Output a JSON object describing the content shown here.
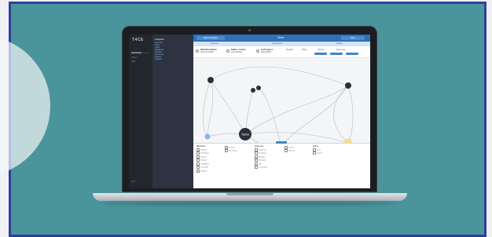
{
  "app": {
    "logo": "T4CE",
    "title": "Tasks",
    "top_left_button": "Select Analytics",
    "top_right_button": "Save"
  },
  "sidebar": {
    "items": [
      {
        "label": "Dashboard",
        "active": true
      },
      {
        "label": "Admin",
        "active": false
      },
      {
        "label": "Help",
        "active": false
      }
    ],
    "footer": "v1.0"
  },
  "subpanel": {
    "title": "Analytics",
    "links": [
      "Overview",
      "Users",
      "Tasks",
      "Workflows",
      "Timeline",
      "Resources",
      "Reports",
      "Settings"
    ]
  },
  "subbar": {
    "left": "Overview",
    "center": "Comparison",
    "right": "Details"
  },
  "stats": [
    {
      "title": "Workflow Name",
      "sub": "Analysis Details"
    },
    {
      "title": "Status: Active",
      "sub": "Last updated"
    },
    {
      "title": "In Progress",
      "sub": "Responsible"
    }
  ],
  "stat_cols": [
    "Duration",
    "Tasks",
    "Owners",
    "Resources"
  ],
  "graph": {
    "nodes": [
      {
        "id": "n1",
        "label": "",
        "color": "#2c2f3a"
      },
      {
        "id": "n2",
        "label": "",
        "color": "#2c2f3a"
      },
      {
        "id": "n3",
        "label": "",
        "color": "#2c2f3a"
      },
      {
        "id": "tasks",
        "label": "Tasks",
        "color": "#2c2f3a"
      },
      {
        "id": "n5",
        "label": "",
        "color": "#2c2f3a"
      },
      {
        "id": "n6",
        "label": "",
        "color": "#2c2f3a"
      },
      {
        "id": "left",
        "label": "",
        "color": "#8fb4e8"
      },
      {
        "id": "right",
        "label": "",
        "color": "#f3e08a"
      }
    ]
  },
  "legend": {
    "tab": "Legend",
    "columns": [
      {
        "header": "Milestones",
        "items": [
          "Planned",
          "Scheduled",
          "Started",
          "Delayed",
          "Completed",
          "Cancelled",
          "Pending"
        ]
      },
      {
        "header": "",
        "items": [
          "Primary",
          "Secondary"
        ]
      },
      {
        "header": "Resources",
        "items": [
          "Engineers",
          "Designers",
          "Analysts",
          "Managers",
          "QA",
          "Contractors"
        ]
      },
      {
        "header": "",
        "items": [
          "Internal",
          "External"
        ]
      },
      {
        "header": "Status",
        "items": [
          "Open",
          "Closed"
        ]
      }
    ]
  },
  "colors": {
    "frame_border": "#2f3f9e",
    "background": "#4a949c",
    "accent": "#2e6fb8"
  }
}
